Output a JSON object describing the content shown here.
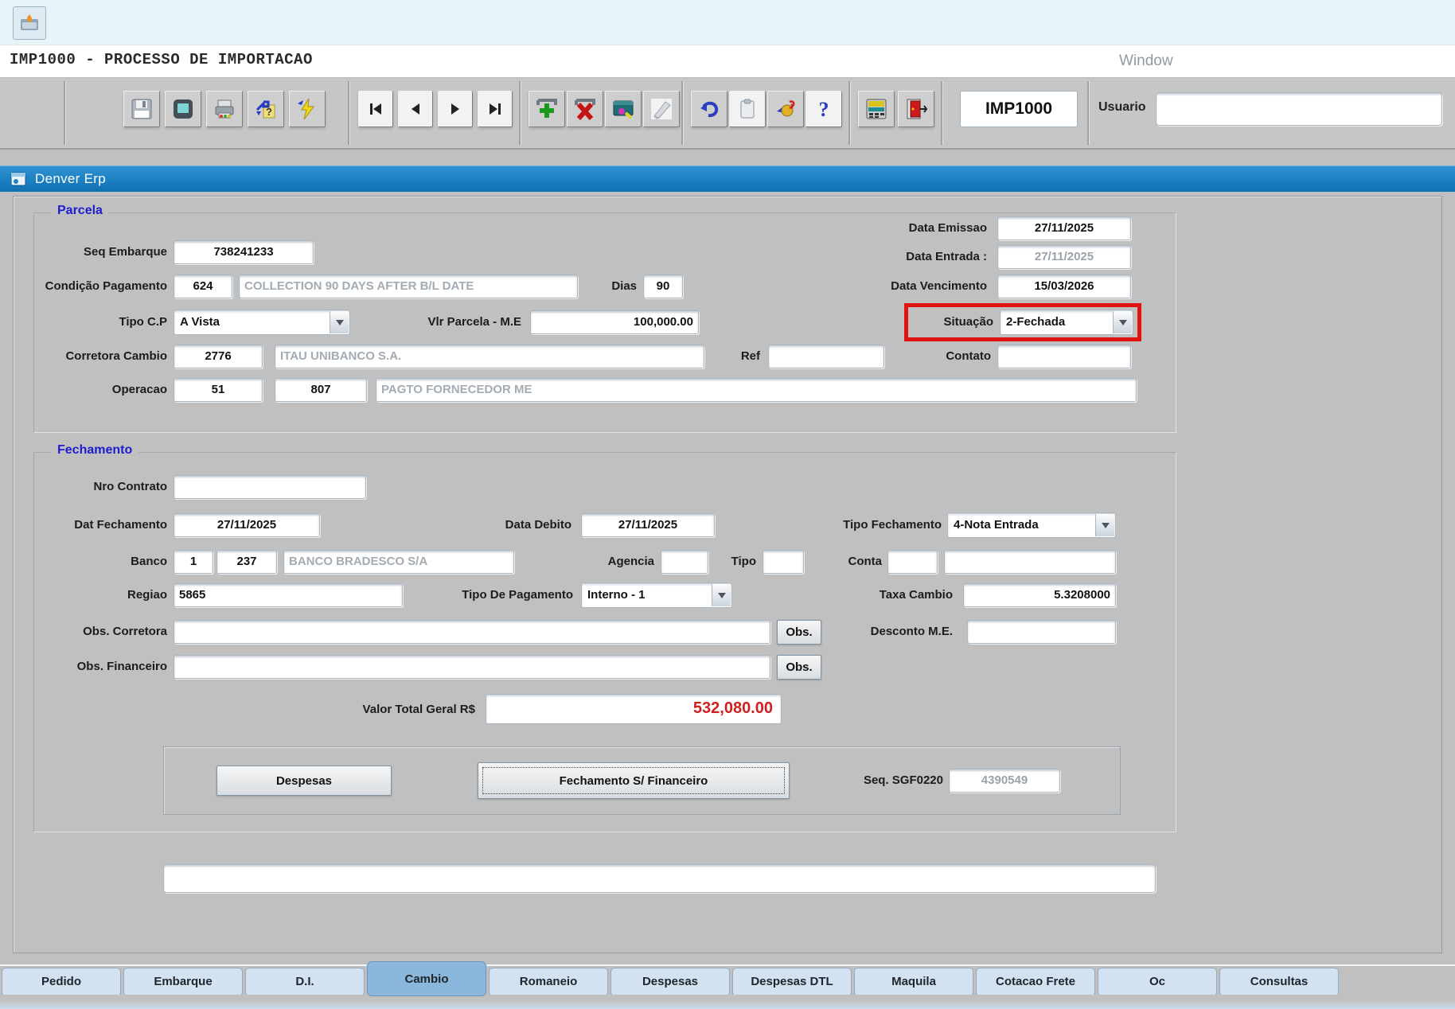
{
  "window": {
    "title": "IMP1000 - PROCESSO DE IMPORTACAO",
    "menu_right": "Window",
    "app_bar": "Denver Erp",
    "program_code": "IMP1000",
    "usuario_label": "Usuario",
    "usuario_value": ""
  },
  "toolbar_icons": [
    "save-icon",
    "screen-icon",
    "print-icon",
    "context-help-icon",
    "run-icon",
    "first-record-icon",
    "previous-record-icon",
    "next-record-icon",
    "last-record-icon",
    "add-record-icon",
    "delete-record-icon",
    "query-icon",
    "clear-icon",
    "undo-icon",
    "paste-icon",
    "coin-hand-icon",
    "help-icon",
    "calculator-icon",
    "exit-icon"
  ],
  "colors": {
    "titlebar_blue": "#1a82c6",
    "highlight_red": "#e21212",
    "total_red": "#cf1f1f",
    "active_tab_blue": "#8bb7dc",
    "group_label_blue": "#1d1dcf"
  },
  "parcela": {
    "title": "Parcela",
    "seq_embarque": {
      "label": "Seq Embarque",
      "value": "738241233"
    },
    "data_emissao": {
      "label": "Data Emissao",
      "value": "27/11/2025"
    },
    "data_entrada": {
      "label": "Data Entrada :",
      "value": "27/11/2025"
    },
    "condicao_pagamento": {
      "label": "Condição Pagamento",
      "code": "624",
      "desc": "COLLECTION 90 DAYS AFTER B/L DATE"
    },
    "dias": {
      "label": "Dias",
      "value": "90"
    },
    "data_vencimento": {
      "label": "Data Vencimento",
      "value": "15/03/2026"
    },
    "tipo_cp": {
      "label": "Tipo C.P",
      "value": "A Vista"
    },
    "vlr_parcela": {
      "label": "Vlr Parcela - M.E",
      "value": "100,000.00"
    },
    "situacao": {
      "label": "Situação",
      "value": "2-Fechada"
    },
    "corretora_cambio": {
      "label": "Corretora Cambio",
      "code": "2776",
      "desc": "ITAU UNIBANCO S.A."
    },
    "ref": {
      "label": "Ref",
      "value": ""
    },
    "contato": {
      "label": "Contato",
      "value": ""
    },
    "operacao": {
      "label": "Operacao",
      "code1": "51",
      "code2": "807",
      "desc": "PAGTO FORNECEDOR ME"
    }
  },
  "fechamento": {
    "title": "Fechamento",
    "nro_contrato": {
      "label": "Nro Contrato",
      "value": ""
    },
    "dat_fechamento": {
      "label": "Dat Fechamento",
      "value": "27/11/2025"
    },
    "data_debito": {
      "label": "Data Debito",
      "value": "27/11/2025"
    },
    "tipo_fechamento": {
      "label": "Tipo Fechamento",
      "value": "4-Nota Entrada"
    },
    "banco": {
      "label": "Banco",
      "code1": "1",
      "code2": "237",
      "desc": "BANCO BRADESCO S/A"
    },
    "agencia": {
      "label": "Agencia",
      "value": ""
    },
    "tipo": {
      "label": "Tipo",
      "value": ""
    },
    "conta": {
      "label": "Conta",
      "value1": "",
      "value2": ""
    },
    "regiao": {
      "label": "Regiao",
      "value": "5865"
    },
    "tipo_pagamento": {
      "label": "Tipo De Pagamento",
      "value": "Interno - 1"
    },
    "taxa_cambio": {
      "label": "Taxa Cambio",
      "value": "5.3208000"
    },
    "obs_corretora": {
      "label": "Obs. Corretora",
      "value": "",
      "button": "Obs."
    },
    "desconto_me": {
      "label": "Desconto M.E.",
      "value": ""
    },
    "obs_financeiro": {
      "label": "Obs. Financeiro",
      "value": "",
      "button": "Obs."
    },
    "valor_total": {
      "label": "Valor Total Geral R$",
      "value": "532,080.00"
    },
    "buttons": {
      "despesas": "Despesas",
      "fechamento_financeiro": "Fechamento S/ Financeiro"
    },
    "seq_sgf": {
      "label": "Seq. SGF0220",
      "value": "4390549"
    }
  },
  "status_message": "",
  "tabs": [
    {
      "label": "Pedido",
      "active": false
    },
    {
      "label": "Embarque",
      "active": false
    },
    {
      "label": "D.I.",
      "active": false
    },
    {
      "label": "Cambio",
      "active": true
    },
    {
      "label": "Romaneio",
      "active": false
    },
    {
      "label": "Despesas",
      "active": false
    },
    {
      "label": "Despesas DTL",
      "active": false
    },
    {
      "label": "Maquila",
      "active": false
    },
    {
      "label": "Cotacao Frete",
      "active": false
    },
    {
      "label": "Oc",
      "active": false
    },
    {
      "label": "Consultas",
      "active": false
    }
  ]
}
